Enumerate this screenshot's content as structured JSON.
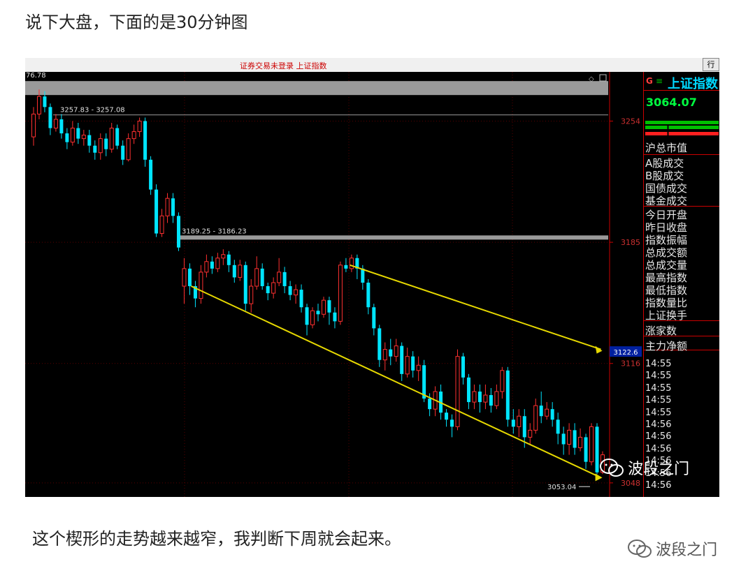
{
  "page": {
    "headline": "说下大盘，下面的是30分钟图",
    "caption": "这个楔形的走势越来越窄，我判断下周就会起来。",
    "watermark_text": "波段之门",
    "watermark_icon": "wechat-icon"
  },
  "window": {
    "title": "证券交易未登录 上证指数",
    "corner_button": "行"
  },
  "sidebar": {
    "g_label": "G",
    "menu_icon": "menu-icon",
    "index_name": "上证指数",
    "index_value": "3064.07",
    "labels": [
      "沪总市值",
      "A股成交",
      "B股成交",
      "国债成交",
      "基金成交",
      "今日开盘",
      "昨日收盘",
      "指数振幅",
      "总成交额",
      "总成交量",
      "最高指数",
      "最低指数",
      "指数量比",
      "上证换手",
      "涨家数",
      "主力净额"
    ],
    "times": [
      "14:55",
      "14:55",
      "14:55",
      "14:55",
      "14:55",
      "14:56",
      "14:56",
      "14:56",
      "14:56",
      "14:56",
      "14:56"
    ],
    "colors": {
      "green": "#00ff40",
      "red": "#ff2020",
      "border": "#cc0000",
      "cyan": "#00d8ff"
    }
  },
  "chart_data": {
    "type": "candlestick",
    "timeframe": "30分钟",
    "ylim": [
      3040,
      3282
    ],
    "y_ticks": [
      3254,
      3185,
      3116,
      3048
    ],
    "top_left_label": "76.78",
    "gaps": [
      {
        "label": "3257.83 - 3257.08",
        "y": 3257.5
      },
      {
        "label": "3189.25 - 3186.23",
        "y": 3187.7
      }
    ],
    "current_price_label": "3122.6",
    "low_label": "3053.04",
    "trendlines": {
      "upper": {
        "from": [
          3182,
          3172
        ],
        "to": [
          3072,
          3124
        ]
      },
      "lower": {
        "from": [
          3162,
          3160
        ],
        "to": [
          3055,
          3051
        ]
      }
    },
    "colors": {
      "up": "#ff3030",
      "down": "#00e5ff",
      "trendline": "#e6d800",
      "gap_band": "#9a9a9a"
    },
    "candles": [
      [
        3245,
        3258,
        3240,
        3262
      ],
      [
        3258,
        3268,
        3255,
        3272
      ],
      [
        3268,
        3262,
        3259,
        3271
      ],
      [
        3262,
        3250,
        3246,
        3264
      ],
      [
        3250,
        3255,
        3248,
        3258
      ],
      [
        3255,
        3247,
        3244,
        3258
      ],
      [
        3247,
        3242,
        3238,
        3250
      ],
      [
        3242,
        3250,
        3240,
        3254
      ],
      [
        3250,
        3244,
        3241,
        3253
      ],
      [
        3244,
        3246,
        3240,
        3249
      ],
      [
        3246,
        3240,
        3236,
        3249
      ],
      [
        3240,
        3236,
        3232,
        3243
      ],
      [
        3236,
        3244,
        3232,
        3247
      ],
      [
        3244,
        3238,
        3234,
        3247
      ],
      [
        3238,
        3250,
        3236,
        3253
      ],
      [
        3250,
        3240,
        3238,
        3252
      ],
      [
        3240,
        3232,
        3229,
        3243
      ],
      [
        3232,
        3244,
        3231,
        3247
      ],
      [
        3244,
        3248,
        3241,
        3252
      ],
      [
        3248,
        3254,
        3245,
        3256
      ],
      [
        3254,
        3232,
        3228,
        3256
      ],
      [
        3232,
        3215,
        3212,
        3234
      ],
      [
        3215,
        3190,
        3188,
        3218
      ],
      [
        3190,
        3200,
        3188,
        3204
      ],
      [
        3200,
        3210,
        3196,
        3213
      ],
      [
        3210,
        3200,
        3196,
        3213
      ],
      [
        3200,
        3182,
        3180,
        3202
      ],
      [
        3160,
        3170,
        3150,
        3176
      ],
      [
        3170,
        3160,
        3155,
        3173
      ],
      [
        3160,
        3153,
        3148,
        3163
      ],
      [
        3153,
        3168,
        3150,
        3172
      ],
      [
        3168,
        3174,
        3165,
        3178
      ],
      [
        3174,
        3170,
        3167,
        3177
      ],
      [
        3170,
        3176,
        3168,
        3179
      ],
      [
        3176,
        3178,
        3172,
        3181
      ],
      [
        3178,
        3172,
        3168,
        3180
      ],
      [
        3172,
        3165,
        3162,
        3175
      ],
      [
        3165,
        3172,
        3163,
        3175
      ],
      [
        3172,
        3150,
        3146,
        3174
      ],
      [
        3150,
        3160,
        3145,
        3164
      ],
      [
        3160,
        3170,
        3158,
        3177
      ],
      [
        3170,
        3160,
        3158,
        3173
      ],
      [
        3160,
        3156,
        3152,
        3162
      ],
      [
        3156,
        3162,
        3153,
        3165
      ],
      [
        3162,
        3168,
        3160,
        3176
      ],
      [
        3168,
        3160,
        3156,
        3171
      ],
      [
        3160,
        3155,
        3152,
        3163
      ],
      [
        3155,
        3158,
        3150,
        3161
      ],
      [
        3158,
        3148,
        3145,
        3161
      ],
      [
        3148,
        3138,
        3132,
        3150
      ],
      [
        3138,
        3146,
        3136,
        3148
      ],
      [
        3146,
        3144,
        3140,
        3150
      ],
      [
        3144,
        3152,
        3142,
        3154
      ],
      [
        3152,
        3145,
        3138,
        3154
      ],
      [
        3145,
        3140,
        3136,
        3148
      ],
      [
        3140,
        3172,
        3138,
        3174
      ],
      [
        3172,
        3170,
        3168,
        3176
      ],
      [
        3170,
        3176,
        3168,
        3178
      ],
      [
        3176,
        3170,
        3164,
        3178
      ],
      [
        3170,
        3162,
        3158,
        3172
      ],
      [
        3162,
        3148,
        3144,
        3164
      ],
      [
        3148,
        3136,
        3132,
        3150
      ],
      [
        3136,
        3118,
        3114,
        3138
      ],
      [
        3118,
        3124,
        3112,
        3128
      ],
      [
        3124,
        3120,
        3115,
        3130
      ],
      [
        3120,
        3126,
        3117,
        3130
      ],
      [
        3126,
        3110,
        3106,
        3128
      ],
      [
        3110,
        3120,
        3108,
        3125
      ],
      [
        3120,
        3112,
        3108,
        3123
      ],
      [
        3112,
        3115,
        3106,
        3120
      ],
      [
        3115,
        3096,
        3094,
        3118
      ],
      [
        3096,
        3090,
        3086,
        3099
      ],
      [
        3090,
        3100,
        3086,
        3103
      ],
      [
        3100,
        3088,
        3084,
        3104
      ],
      [
        3088,
        3084,
        3080,
        3090
      ],
      [
        3084,
        3080,
        3074,
        3087
      ],
      [
        3080,
        3120,
        3078,
        3124
      ],
      [
        3120,
        3108,
        3104,
        3122
      ],
      [
        3108,
        3094,
        3090,
        3110
      ],
      [
        3094,
        3100,
        3090,
        3104
      ],
      [
        3100,
        3094,
        3088,
        3104
      ],
      [
        3094,
        3098,
        3090,
        3104
      ],
      [
        3098,
        3092,
        3088,
        3102
      ],
      [
        3092,
        3100,
        3090,
        3104
      ],
      [
        3100,
        3112,
        3096,
        3114
      ],
      [
        3112,
        3084,
        3080,
        3114
      ],
      [
        3084,
        3080,
        3076,
        3090
      ],
      [
        3080,
        3086,
        3074,
        3090
      ],
      [
        3086,
        3074,
        3068,
        3090
      ],
      [
        3074,
        3078,
        3070,
        3082
      ],
      [
        3078,
        3092,
        3076,
        3096
      ],
      [
        3092,
        3086,
        3082,
        3100
      ],
      [
        3086,
        3090,
        3084,
        3094
      ],
      [
        3090,
        3084,
        3080,
        3094
      ],
      [
        3084,
        3076,
        3070,
        3088
      ],
      [
        3076,
        3070,
        3064,
        3080
      ],
      [
        3070,
        3078,
        3064,
        3082
      ],
      [
        3078,
        3068,
        3064,
        3082
      ],
      [
        3068,
        3074,
        3066,
        3079
      ],
      [
        3074,
        3060,
        3056,
        3076
      ],
      [
        3060,
        3080,
        3058,
        3082
      ],
      [
        3080,
        3054,
        3053,
        3082
      ],
      [
        3054,
        3064,
        3053,
        3066
      ]
    ]
  }
}
